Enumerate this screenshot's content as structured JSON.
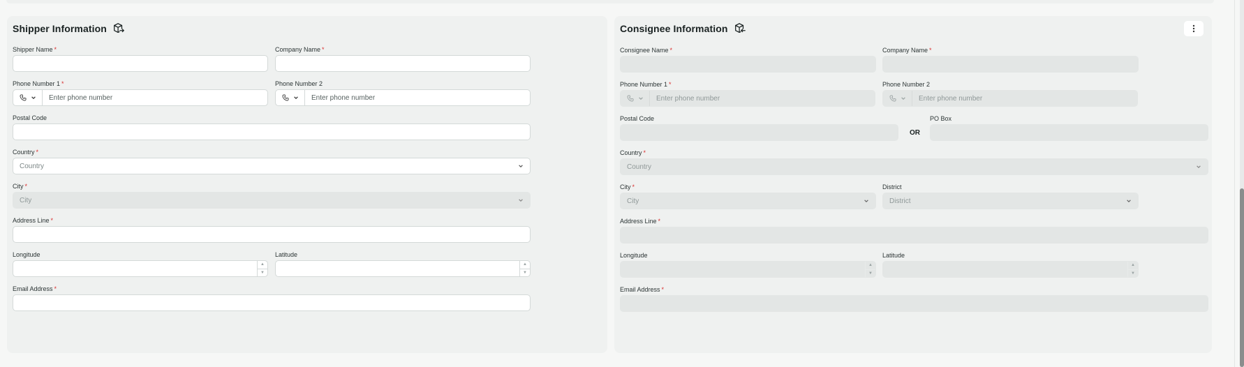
{
  "shipper": {
    "title": "Shipper Information",
    "shipper_name_label": "Shipper Name",
    "company_name_label": "Company Name",
    "phone1_label": "Phone Number 1",
    "phone2_label": "Phone Number 2",
    "phone_placeholder": "Enter phone number",
    "postal_code_label": "Postal Code",
    "country_label": "Country",
    "country_placeholder": "Country",
    "city_label": "City",
    "city_placeholder": "City",
    "address_label": "Address Line",
    "longitude_label": "Longitude",
    "latitude_label": "Latitude",
    "email_label": "Email Address"
  },
  "consignee": {
    "title": "Consignee Information",
    "consignee_name_label": "Consignee Name",
    "company_name_label": "Company Name",
    "phone1_label": "Phone Number 1",
    "phone2_label": "Phone Number 2",
    "phone_placeholder": "Enter phone number",
    "postal_code_label": "Postal Code",
    "or_label": "OR",
    "po_box_label": "PO Box",
    "country_label": "Country",
    "country_placeholder": "Country",
    "city_label": "City",
    "city_placeholder": "City",
    "district_label": "District",
    "district_placeholder": "District",
    "address_label": "Address Line",
    "longitude_label": "Longitude",
    "latitude_label": "Latitude",
    "email_label": "Email Address"
  },
  "required_mark": "*",
  "icons": {
    "shipper_title_icon": "package-export-icon",
    "consignee_title_icon": "package-import-icon",
    "menu_icon": "kebab-menu-icon",
    "phone_icon": "phone-icon",
    "chevron_icon": "chevron-down-icon"
  },
  "colors": {
    "required": "#d93030",
    "panel_bg": "#eff1f0",
    "disabled_field": "#e3e6e5"
  }
}
